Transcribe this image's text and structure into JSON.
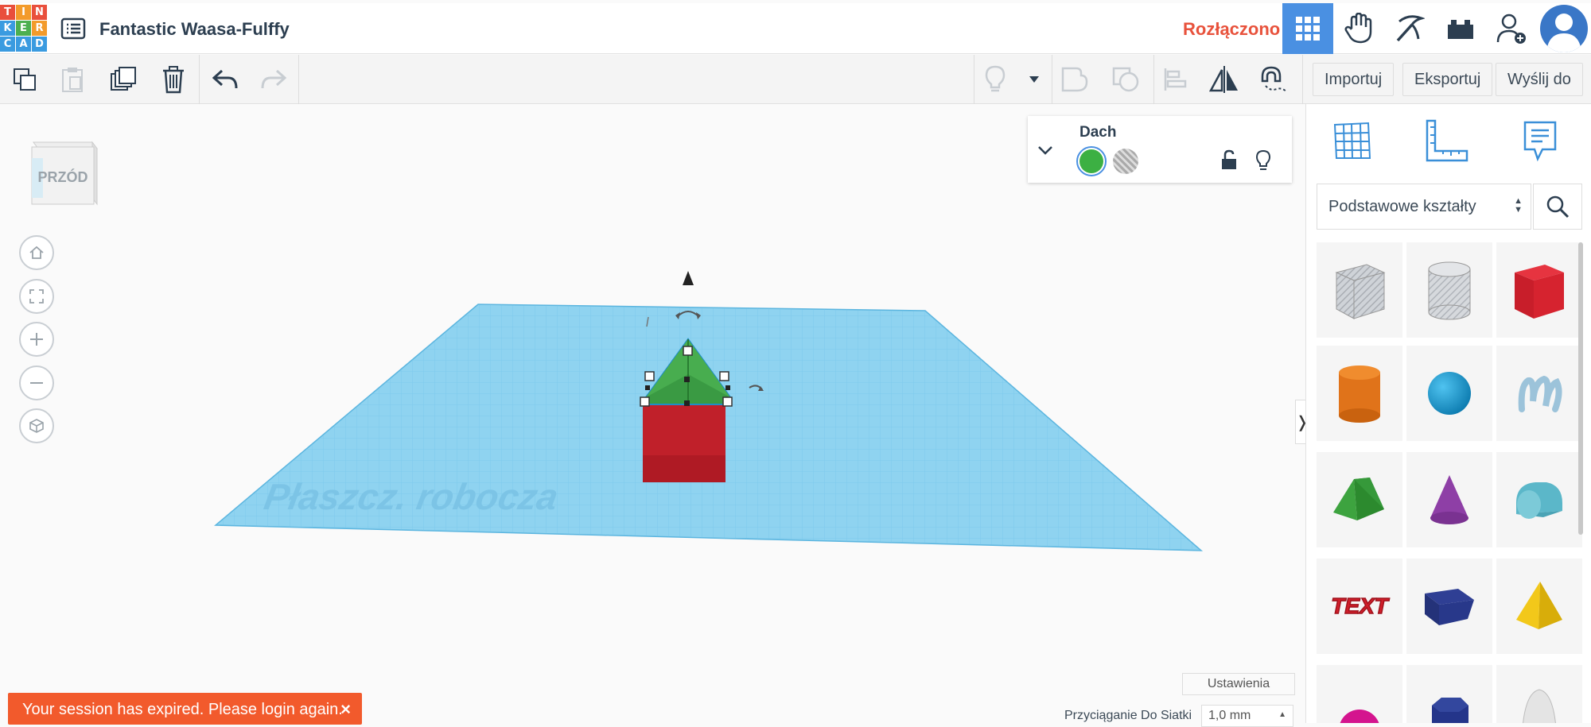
{
  "app": {
    "logo_letters": [
      "T",
      "I",
      "N",
      "K",
      "E",
      "R",
      "C",
      "A",
      "D"
    ],
    "title": "Fantastic Waasa-Fulffy",
    "connection_status": "Rozłączono"
  },
  "toolbar": {
    "import_label": "Importuj",
    "export_label": "Eksportuj",
    "send_label": "Wyślij do"
  },
  "viewport": {
    "viewcube_label": "PRZÓD",
    "workplane_label": "Płaszcz. robocza",
    "settings_label": "Ustawienia",
    "snap_label": "Przyciąganie Do Siatki",
    "snap_value": "1,0 mm"
  },
  "props_panel": {
    "shape_name": "Dach",
    "solid_color": "#3cb043"
  },
  "sidebar": {
    "library": "Podstawowe kształty",
    "shapes": [
      {
        "name": "box-hole-shape"
      },
      {
        "name": "cylinder-hole-shape"
      },
      {
        "name": "box-shape"
      },
      {
        "name": "cylinder-shape"
      },
      {
        "name": "sphere-shape"
      },
      {
        "name": "scribble-shape"
      },
      {
        "name": "roof-shape"
      },
      {
        "name": "cone-shape"
      },
      {
        "name": "round-roof-shape"
      },
      {
        "name": "text-shape",
        "text": "TEXT"
      },
      {
        "name": "wedge-shape"
      },
      {
        "name": "pyramid-shape"
      },
      {
        "name": "half-sphere-shape"
      },
      {
        "name": "polygon-shape"
      },
      {
        "name": "paraboloid-shape"
      }
    ]
  },
  "toast": {
    "message": "Your session has expired. Please login again."
  },
  "colors": {
    "accent": "#4a90e2",
    "status_red": "#e8523c",
    "toast": "#f25a2c",
    "workplane": "#8fd3f0"
  }
}
